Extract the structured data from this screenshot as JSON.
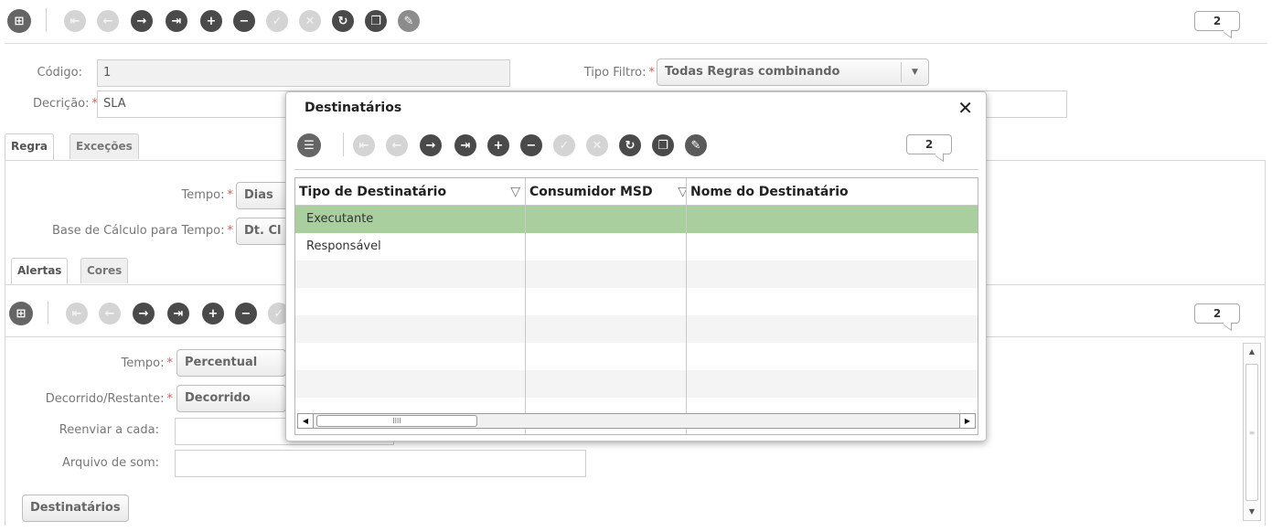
{
  "toolbar": {
    "icons": [
      "columns-icon",
      "first-icon",
      "previous-icon",
      "next-icon",
      "last-icon",
      "add-icon",
      "remove-icon",
      "confirm-icon",
      "cancel-icon",
      "refresh-icon",
      "copy-icon",
      "edit-icon"
    ],
    "counter": "2"
  },
  "form": {
    "codigo_label": "Código:",
    "codigo_value": "1",
    "descricao_label": "Decrição:",
    "descricao_value": "SLA",
    "tipo_filtro_label": "Tipo Filtro:",
    "tipo_filtro_value": "Todas Regras combinando",
    "required_mark": "*"
  },
  "tabs": {
    "regra": "Regra",
    "excecoes": "Exceções"
  },
  "regra": {
    "tempo_label": "Tempo:",
    "tempo_value": "Dias",
    "base_label": "Base de Cálculo para Tempo:",
    "base_value": "Dt. Cl"
  },
  "subtabs": {
    "alertas": "Alertas",
    "cores": "Cores"
  },
  "alertas": {
    "counter": "2",
    "tempo_label": "Tempo:",
    "tempo_value": "Percentual",
    "decorrido_label": "Decorrido/Restante:",
    "decorrido_value": "Decorrido",
    "reenviar_label": "Reenviar a cada:",
    "reenviar_value": "",
    "arquivo_label": "Arquivo de som:",
    "arquivo_value": "",
    "destinatarios_button": "Destinatários"
  },
  "dialog": {
    "title": "Destinatários",
    "close": "✕",
    "counter": "2",
    "columns": [
      "Tipo de Destinatário",
      "Consumidor MSD",
      "Nome do Destinatário"
    ],
    "rows": [
      {
        "tipo": "Executante",
        "consumidor": "",
        "nome": ""
      },
      {
        "tipo": "Responsável",
        "consumidor": "",
        "nome": ""
      }
    ],
    "selected_row_color": "#a9cf9f"
  }
}
